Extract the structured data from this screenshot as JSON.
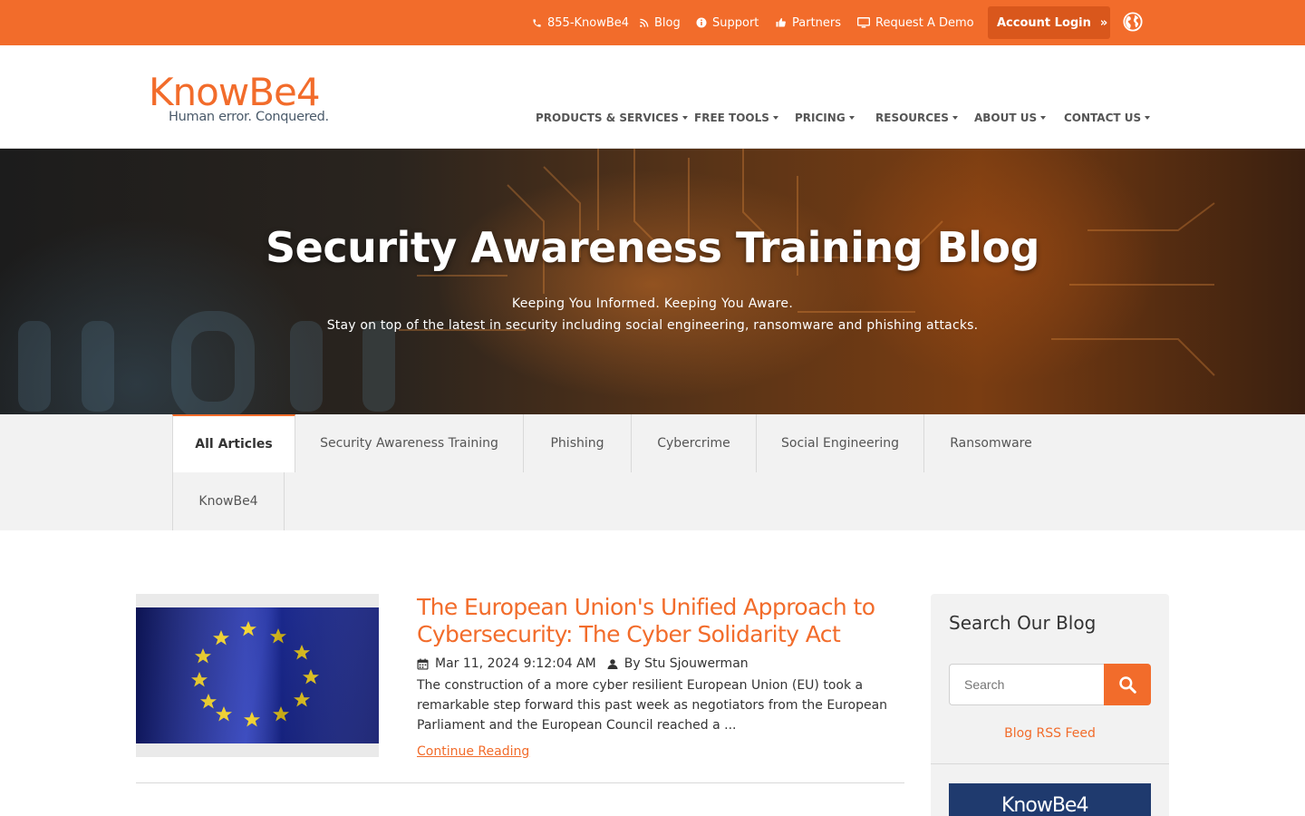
{
  "topbar": {
    "phone": "855-KnowBe4",
    "blog": "Blog",
    "support": "Support",
    "partners": "Partners",
    "demo": "Request A Demo",
    "account_login": "Account Login"
  },
  "brand": {
    "logo_word": "KnowBe4",
    "logo_tagline": "Human error. Conquered.",
    "accent_color": "#f26c2b"
  },
  "nav": {
    "items": [
      {
        "label": "PRODUCTS & SERVICES"
      },
      {
        "label": "FREE TOOLS"
      },
      {
        "label": "PRICING"
      },
      {
        "label": "RESOURCES"
      },
      {
        "label": "ABOUT US"
      },
      {
        "label": "CONTACT US"
      }
    ]
  },
  "hero": {
    "title": "Security Awareness Training Blog",
    "subtitle_1": "Keeping You Informed. Keeping You Aware.",
    "subtitle_2": "Stay on top of the latest in security including social engineering, ransomware and phishing attacks."
  },
  "categories": {
    "tabs": [
      {
        "label": "All Articles",
        "active": true
      },
      {
        "label": "Security Awareness Training"
      },
      {
        "label": "Phishing"
      },
      {
        "label": "Cybercrime"
      },
      {
        "label": "Social Engineering"
      },
      {
        "label": "Ransomware"
      },
      {
        "label": "KnowBe4"
      }
    ]
  },
  "article": {
    "title": "The European Union's Unified Approach to Cybersecurity: The Cyber Solidarity Act",
    "date": "Mar 11, 2024 9:12:04 AM",
    "author": "By Stu Sjouwerman",
    "excerpt": "The construction of a more cyber resilient European Union (EU) took a remarkable step forward this past week as negotiators from the European Parliament and the European Council reached a ...",
    "read_more": "Continue Reading",
    "thumbnail": "eu-flag-image"
  },
  "sidebar": {
    "heading": "Search Our Blog",
    "search_placeholder": "Search",
    "rss_link": "Blog RSS Feed",
    "banner_word": "KnowBe4"
  }
}
